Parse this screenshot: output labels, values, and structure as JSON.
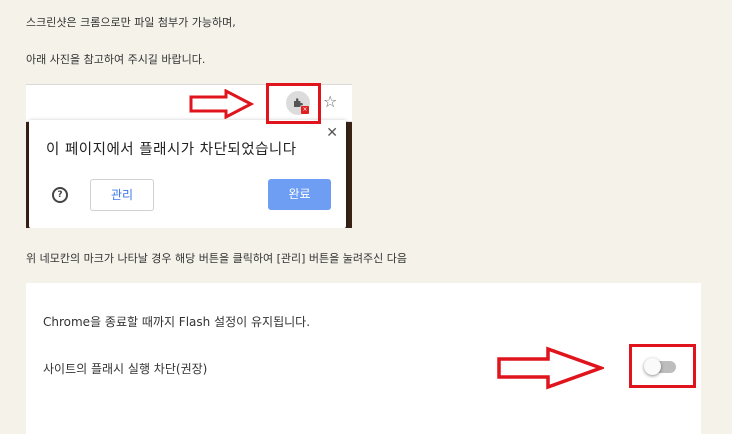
{
  "instructions": {
    "line1": "스크린샷은 크롬으로만 파일 첨부가 가능하며,",
    "line2": "아래 사진을 참고하여 주시길 바랍니다.",
    "line3": "위 네모칸의 마크가 나타날 경우 해당 버튼을 클릭하여 [관리] 버튼을 눌려주신 다음"
  },
  "screenshot1": {
    "dialog_title": "이 페이지에서 플래시가 차단되었습니다",
    "close_symbol": "✕",
    "help_symbol": "?",
    "manage_label": "관리",
    "done_label": "완료",
    "star_symbol": "☆"
  },
  "screenshot2": {
    "info_text": "Chrome을 종료할 때까지 Flash 설정이 유지됩니다.",
    "setting_label": "사이트의 플래시 실행 차단(권장)",
    "toggle_on": false
  },
  "colors": {
    "highlight_red": "#e0141c",
    "primary_blue": "#6e9ef3",
    "page_background": "#f5f2ea"
  },
  "icons": [
    "extension-puzzle-icon",
    "blocked-badge-icon",
    "star-icon",
    "close-icon",
    "help-icon",
    "right-arrow-icon"
  ]
}
